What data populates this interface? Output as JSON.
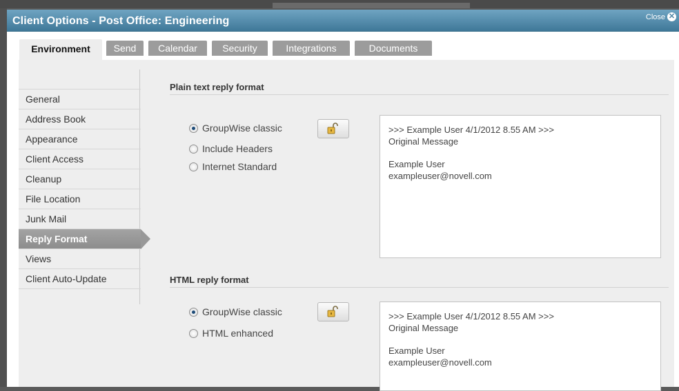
{
  "window": {
    "title": "Client Options - Post Office: Engineering",
    "close_label": "Close"
  },
  "tabs": [
    {
      "label": "Environment",
      "active": true
    },
    {
      "label": "Send"
    },
    {
      "label": "Calendar"
    },
    {
      "label": "Security"
    },
    {
      "label": "Integrations"
    },
    {
      "label": "Documents"
    }
  ],
  "sidebar": {
    "items": [
      {
        "label": "General"
      },
      {
        "label": "Address Book"
      },
      {
        "label": "Appearance"
      },
      {
        "label": "Client Access"
      },
      {
        "label": "Cleanup"
      },
      {
        "label": "File Location"
      },
      {
        "label": "Junk Mail"
      },
      {
        "label": "Reply Format",
        "active": true
      },
      {
        "label": "Views"
      },
      {
        "label": "Client Auto-Update"
      }
    ]
  },
  "plain_text": {
    "title": "Plain text reply format",
    "options": [
      {
        "label": "GroupWise classic",
        "checked": true
      },
      {
        "label": "Include Headers",
        "checked": false
      },
      {
        "label": "Internet Standard",
        "checked": false
      }
    ],
    "preview": {
      "header": ">>> Example User 4/1/2012 8.55 AM >>>",
      "body": "Original Message",
      "signature_name": "Example User",
      "signature_email": "exampleuser@novell.com"
    }
  },
  "html": {
    "title": "HTML reply format",
    "options": [
      {
        "label": "GroupWise classic",
        "checked": true
      },
      {
        "label": "HTML enhanced",
        "checked": false
      }
    ],
    "preview": {
      "header": ">>> Example User 4/1/2012 8.55 AM >>>",
      "body": "Original Message",
      "signature_name": "Example User",
      "signature_email": "exampleuser@novell.com"
    }
  },
  "icons": {
    "lock": "unlocked-padlock-icon",
    "close": "close-icon"
  }
}
